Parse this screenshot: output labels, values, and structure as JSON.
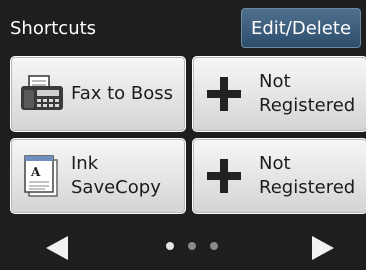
{
  "header": {
    "title": "Shortcuts",
    "edit_button_label": "Edit/Delete"
  },
  "tiles": [
    {
      "icon": "fax-icon",
      "line1": "Fax to Boss",
      "line2": ""
    },
    {
      "icon": "plus-icon",
      "line1": "Not",
      "line2": "Registered"
    },
    {
      "icon": "document-icon",
      "line1": "Ink",
      "line2": "SaveCopy"
    },
    {
      "icon": "plus-icon",
      "line1": "Not",
      "line2": "Registered"
    }
  ],
  "pagination": {
    "current_page": 1,
    "total_pages": 3
  },
  "colors": {
    "background": "#1e1e1e",
    "header_button": "#3e5f7f",
    "tile": "#e6e6e6"
  }
}
